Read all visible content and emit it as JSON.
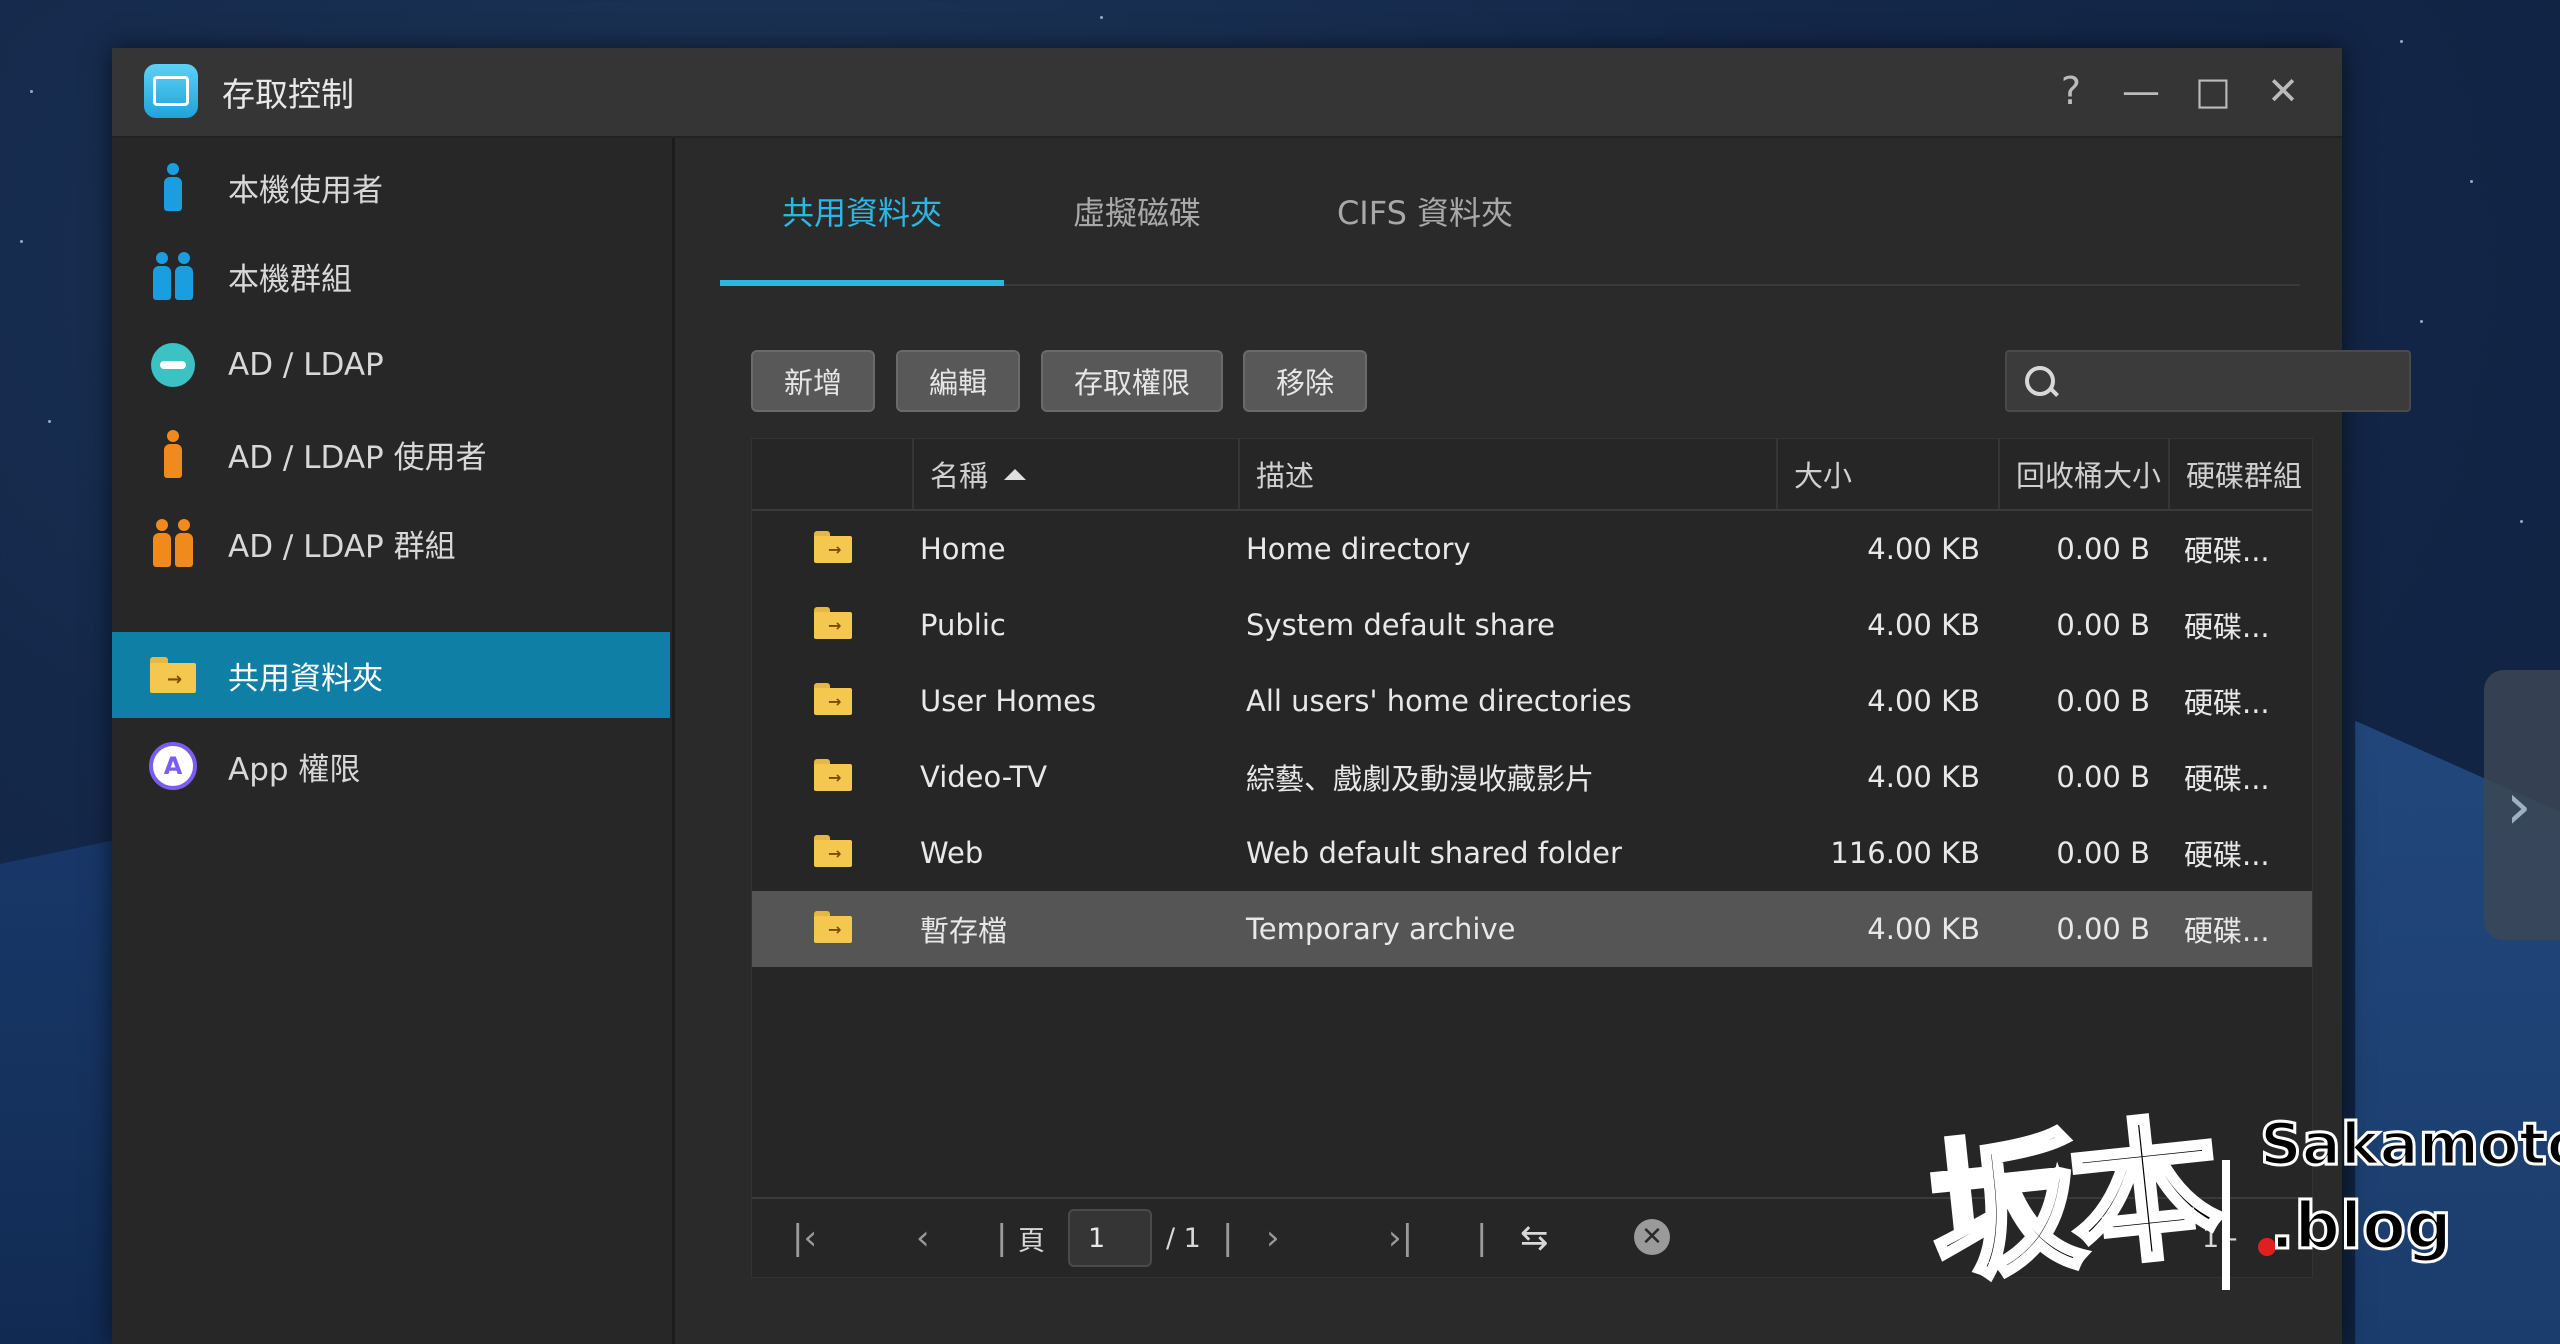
{
  "window": {
    "title": "存取控制"
  },
  "window_controls": {
    "help": "?",
    "minimize": "—",
    "maximize": "□",
    "close": "✕"
  },
  "sidebar": {
    "items": [
      {
        "label": "本機使用者",
        "icon": "user-icon",
        "color": "#1a9ee0"
      },
      {
        "label": "本機群組",
        "icon": "group-icon",
        "color": "#1a9ee0"
      },
      {
        "label": "AD / LDAP",
        "icon": "key-icon",
        "color": "#3cc2c2"
      },
      {
        "label": "AD / LDAP 使用者",
        "icon": "user-icon",
        "color": "#f08a1c"
      },
      {
        "label": "AD / LDAP 群組",
        "icon": "group-icon",
        "color": "#f08a1c"
      },
      {
        "label": "共用資料夾",
        "icon": "shared-folder-icon",
        "color": "#f4c84f",
        "active": true
      },
      {
        "label": "App 權限",
        "icon": "app-icon",
        "color": "#7b5cf0"
      }
    ]
  },
  "tabs": [
    "共用資料夾",
    "虛擬磁碟",
    "CIFS 資料夾"
  ],
  "toolbar": {
    "add": "新增",
    "edit": "編輯",
    "permissions": "存取權限",
    "remove": "移除"
  },
  "search": {
    "placeholder": ""
  },
  "table": {
    "headers": {
      "name": "名稱",
      "description": "描述",
      "size": "大小",
      "recycle": "回收桶大小",
      "volume": "硬碟群組"
    },
    "rows": [
      {
        "name": "Home",
        "description": "Home directory",
        "size": "4.00 KB",
        "recycle": "0.00 B",
        "volume": "硬碟..."
      },
      {
        "name": "Public",
        "description": "System default share",
        "size": "4.00 KB",
        "recycle": "0.00 B",
        "volume": "硬碟..."
      },
      {
        "name": "User Homes",
        "description": "All users' home directories",
        "size": "4.00 KB",
        "recycle": "0.00 B",
        "volume": "硬碟..."
      },
      {
        "name": "Video-TV",
        "description": "綜藝、戲劇及動漫收藏影片",
        "size": "4.00 KB",
        "recycle": "0.00 B",
        "volume": "硬碟..."
      },
      {
        "name": "Web",
        "description": "Web default shared folder",
        "size": "116.00 KB",
        "recycle": "0.00 B",
        "volume": "硬碟..."
      },
      {
        "name": "暫存檔",
        "description": "Temporary archive",
        "size": "4.00 KB",
        "recycle": "0.00 B",
        "volume": "硬碟...",
        "selected": true
      }
    ]
  },
  "pager": {
    "page_label": "頁",
    "current_page": "1",
    "total_pages": "/ 1",
    "range": "1 - "
  },
  "watermark": {
    "main": "坂本",
    "sub1": "Sakamoto",
    "sub2": ".blog"
  },
  "colors": {
    "accent": "#2cb6e3",
    "active_sidebar": "#0f7fa6",
    "selected_row": "#555555"
  }
}
